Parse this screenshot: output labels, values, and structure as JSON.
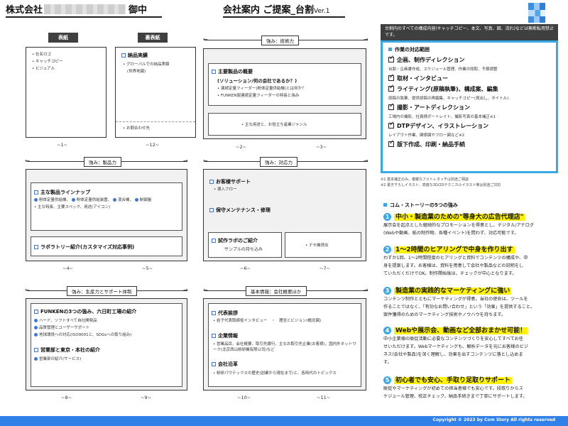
{
  "header": {
    "client_prefix": "株式会社",
    "client_suffix": "御中",
    "title": "会社案内 ご提案_台割",
    "version": "Ver.1"
  },
  "spreads": {
    "s1": {
      "cover_tag": "表紙",
      "back_tag": "裏表紙",
      "cover_items": [
        "社名ロゴ",
        "キャッチコピー",
        "ビジュアル"
      ],
      "back_heading": "納品実績",
      "back_items": [
        "グローバルでの納品実績",
        "(世界地図)"
      ],
      "back_contact": "お問合わせ先",
      "cap_left": "~1~",
      "cap_right": "~12~"
    },
    "s2": {
      "label": "強み：技術力",
      "heading": "主要製品の概要",
      "sub": "(ソリューション/何の会社であるか？)",
      "items": [
        "連続定量フィーダー(粉体定量供給機)とは何か？",
        "FUNKEN製連続定量フィーダーの特長と強み"
      ],
      "bottom": "主な用途と、お役立ち産業ジャンル",
      "cap_left": "~2~",
      "cap_right": "~3~"
    },
    "s3": {
      "label": "強み：製品力",
      "heading": "主な製品ラインナップ",
      "items": [
        "粉体定量供給機、",
        "粉体定量供給装置、",
        "混合機、",
        "制御盤"
      ],
      "sub": "主な特長、主要スペック、用途(アイコン)",
      "heading2": "ラボラトリー紹介(カスタマイズ対応事例)",
      "cap_left": "~4~",
      "cap_right": "~5~"
    },
    "s4": {
      "label": "強み：対応力",
      "heading": "お客様サポート",
      "item": "導入フロー",
      "heading2": "保守メンテナンス・修理",
      "heading3": "試作ラボのご紹介",
      "sub3": "サンプルの持ち込み",
      "right": "デモ機貸出",
      "cap_left": "~6~",
      "cap_right": "~7~"
    },
    "s5": {
      "label": "強み：生産力とサポート体制",
      "heading": "FUNKENの3つの強み、六日町工場の紹介",
      "items": [
        "ハード、ソフトすべて自社開発品",
        "品質管理とユーザーサポート",
        "地球環境への対応(ISO9001と、SDGsへの取り組み)"
      ],
      "heading2": "営業部と東京・本社の紹介",
      "sub2": "営業部の紹介(サービス)",
      "cap_left": "~8~",
      "cap_right": "~9~"
    },
    "s6": {
      "label": "基本情報：会社概要ほか",
      "heading": "代表挨拶",
      "item": "岩子代表取締役インタビュー　・　理念とビジョン(概念図)",
      "heading2": "企業情報",
      "item2": "営業品目、会社概要、取引先銀行、主なお取引先企業(お客様)、国内外ネットワーク(北京西山粉研機有限公司)など",
      "heading3": "会社沿革",
      "item3": "粉研パウテックスの歴史(創業から現在まで)と、各時代のトピックス",
      "cap_left": "~10~",
      "cap_right": "~11~"
    }
  },
  "right": {
    "note": "台割内のすべての構成内容(キャッチコピー、本文、写真、図、流れ)などは無断転用禁止です。",
    "scope_title": "作業の対応範囲",
    "scope": [
      {
        "label": "企画、制作ディレクション",
        "desc": "台割・企画書作成、スケジュール管理、作業の段取、予算調整"
      },
      {
        "label": "取材・インタビュー",
        "desc": ""
      },
      {
        "label": "ライティング(原稿執筆)、構成案、編集",
        "desc": "原稿の執筆、提供原稿の再編集、キャッチコピー(見出し、タイトル)"
      },
      {
        "label": "撮影・アートディレクション",
        "desc": "工場内の撮影、社員様ポートレイト、撮影写真の基本補正※1"
      },
      {
        "label": "DTPデザイン、イラストレーション",
        "desc": "レイアウト作業、関係図やフロー図など※2"
      },
      {
        "label": "版下作成、印刷・納品手続",
        "desc": ""
      }
    ],
    "footnote1": "※1 基本補正のみ。複雑なフォトレタッチは別途ご相談",
    "footnote2": "※2 書き下ろしイラスト、高度な3D/2Dテクニカルイラスト等は別途ご対応",
    "story_title": "コム・ストーリーの5つの強み",
    "points": [
      {
        "num": "1",
        "head": "中小・製造業のための\"等身大の広告代理店\"",
        "body": [
          "展示会を起点とした継続的なプロモーションを得意とし、デジタル/アナログ",
          "(Webや動画、紙の制作物、各種イベント)を問わず、対応可能です。"
        ]
      },
      {
        "num": "2",
        "head": "1〜2時間のヒアリングで中身を作り出す",
        "body": [
          "わずか1回、1〜2時間程度のヒアリングと資料でコンテンツの構成や、中",
          "身を提案します。お客様は、資料を用意して会社や製品などの説明をし",
          "ていただくだけでOK。制作開始後は、チェックが中心となります。"
        ]
      },
      {
        "num": "3",
        "head": "製造業の実践的なマーケティングに強い",
        "body": [
          "コンテンツ制作とともにマーケティングが得意。当社の使命は、ツールを",
          "作ることではなく、「有効なお問い合わせ」という「効果」を提供すること。",
          "案件獲得のためのマーケティング技術やノウハウを持ちます。"
        ]
      },
      {
        "num": "4",
        "head": "Webや展示会、動画など全部おまかせ可能！",
        "body": [
          "中小企業様の販促活動に必要なコンテンツづくりを安心してすべてお任",
          "せいただけます。Webマーケティングも、解析データを元にお客様のビジ",
          "ネス(会社や製品)を深く理解し、効果を出すコンテンツに落とし込めま",
          "す。"
        ]
      },
      {
        "num": "5",
        "head": "初心者でも安心、手取り足取りサポート",
        "body": [
          "販促やマーケティングが初めての担当者様でも安心です。段取りからス",
          "ケジュール管理、校正チェック、納品手続きまで丁寧にサポートします。"
        ]
      }
    ]
  },
  "footer": {
    "copyright": "Copyright © 2023 by Com Story All rights reserved"
  },
  "colors": {
    "accent": "#39a8e6",
    "footer": "#2f80e8",
    "highlight": "#fff200",
    "tag": "#3f3f3f"
  }
}
